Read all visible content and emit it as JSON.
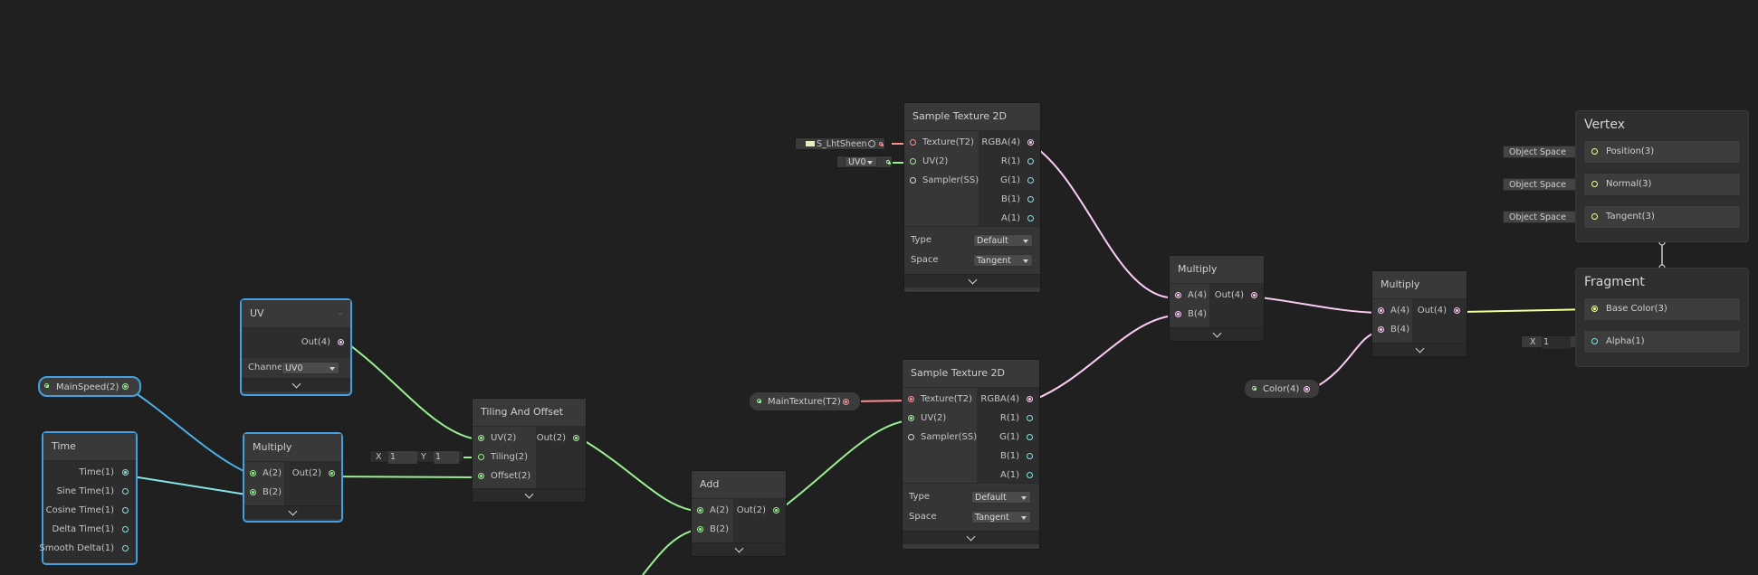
{
  "colors": {
    "float": "#84e4e7",
    "vec2": "#9aef92",
    "vec4": "#fbcbf4",
    "vec3": "#f6ff9a",
    "texture": "#ff8b8b",
    "selected": "#44a0e0"
  },
  "time_node": {
    "title": "Time",
    "outputs": [
      "Time(1)",
      "Sine Time(1)",
      "Cosine Time(1)",
      "Delta Time(1)",
      "Smooth Delta(1)"
    ]
  },
  "main_speed": {
    "label": "MainSpeed(2)"
  },
  "uv_node": {
    "title": "UV",
    "out": "Out(4)",
    "channel_label": "Channe",
    "channel_value": "UV0"
  },
  "multiply1": {
    "title": "Multiply",
    "a": "A(2)",
    "b": "B(2)",
    "out": "Out(2)"
  },
  "tiling_node": {
    "title": "Tiling And Offset",
    "uv": "UV(2)",
    "tiling": "Tiling(2)",
    "offset": "Offset(2)",
    "out": "Out(2)"
  },
  "tiling_inline": {
    "x_label": "X",
    "x_value": "1",
    "y_label": "Y",
    "y_value": "1"
  },
  "add_node": {
    "title": "Add",
    "a": "A(2)",
    "b": "B(2)",
    "out": "Out(2)"
  },
  "main_texture": {
    "label": "MainTexture(T2)"
  },
  "sample1": {
    "title": "Sample Texture 2D",
    "inputs": [
      "Texture(T2)",
      "UV(2)",
      "Sampler(SS)"
    ],
    "outputs": [
      "RGBA(4)",
      "R(1)",
      "G(1)",
      "B(1)",
      "A(1)"
    ],
    "type_label": "Type",
    "type_value": "Default",
    "space_label": "Space",
    "space_value": "Tangent"
  },
  "sample1_inline": {
    "texture": "S_LhtSheen",
    "uv": "UV0"
  },
  "sample2": {
    "title": "Sample Texture 2D",
    "inputs": [
      "Texture(T2)",
      "UV(2)",
      "Sampler(SS)"
    ],
    "outputs": [
      "RGBA(4)",
      "R(1)",
      "G(1)",
      "B(1)",
      "A(1)"
    ],
    "type_label": "Type",
    "type_value": "Default",
    "space_label": "Space",
    "space_value": "Tangent"
  },
  "multiply2": {
    "title": "Multiply",
    "a": "A(4)",
    "b": "B(4)",
    "out": "Out(4)"
  },
  "multiply3": {
    "title": "Multiply",
    "a": "A(4)",
    "b": "B(4)",
    "out": "Out(4)"
  },
  "color_prop": {
    "label": "Color(4)"
  },
  "vertex": {
    "title": "Vertex",
    "slots": [
      "Position(3)",
      "Normal(3)",
      "Tangent(3)"
    ],
    "space_tag": "Object Space"
  },
  "fragment": {
    "title": "Fragment",
    "slots": [
      "Base Color(3)",
      "Alpha(1)"
    ],
    "alpha_x_label": "X",
    "alpha_value": "1"
  }
}
